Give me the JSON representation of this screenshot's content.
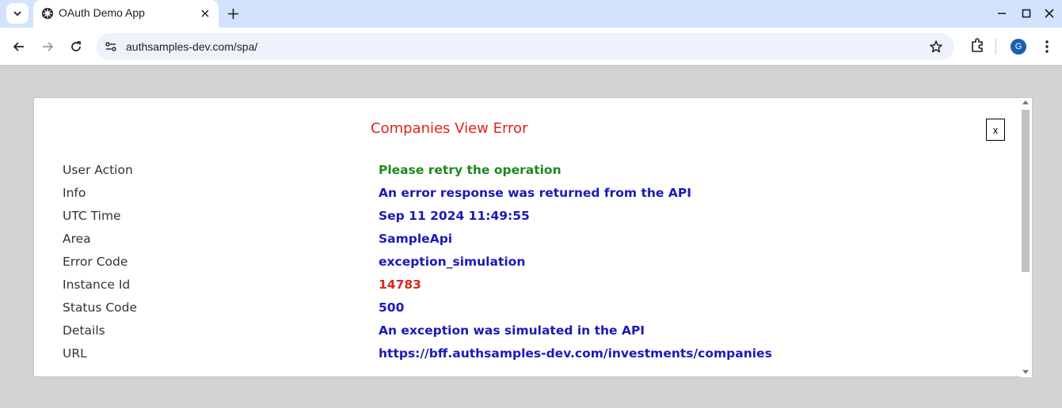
{
  "browser": {
    "tab_title": "OAuth Demo App",
    "url": "authsamples-dev.com/spa/",
    "profile_initial": "G",
    "icons": [
      "tab-search-icon",
      "app-favicon-icon",
      "close-icon",
      "plus-icon",
      "minimize-icon",
      "maximize-icon",
      "close-window-icon",
      "back-arrow-icon",
      "forward-arrow-icon",
      "reload-icon",
      "site-info-icon",
      "star-icon",
      "extensions-icon",
      "more-menu-icon"
    ]
  },
  "dialog": {
    "title": "Companies View Error",
    "close_label": "x",
    "rows": [
      {
        "label": "User Action",
        "value": "Please retry the operation",
        "color": "#1d8a1d"
      },
      {
        "label": "Info",
        "value": "An error response was returned from the API",
        "color": "#1a1ab8"
      },
      {
        "label": "UTC Time",
        "value": "Sep 11 2024 11:49:55",
        "color": "#1a1ab8"
      },
      {
        "label": "Area",
        "value": "SampleApi",
        "color": "#1a1ab8"
      },
      {
        "label": "Error Code",
        "value": "exception_simulation",
        "color": "#1a1ab8"
      },
      {
        "label": "Instance Id",
        "value": "14783",
        "color": "#e0241c"
      },
      {
        "label": "Status Code",
        "value": "500",
        "color": "#1a1ab8"
      },
      {
        "label": "Details",
        "value": "An exception was simulated in the API",
        "color": "#1a1ab8"
      },
      {
        "label": "URL",
        "value": "https://bff.authsamples-dev.com/investments/companies",
        "color": "#1a1ab8"
      }
    ]
  },
  "colors": {
    "title": "#e0241c",
    "tabstrip": "#d3e3fd",
    "page_background": "#d3d3d3"
  }
}
